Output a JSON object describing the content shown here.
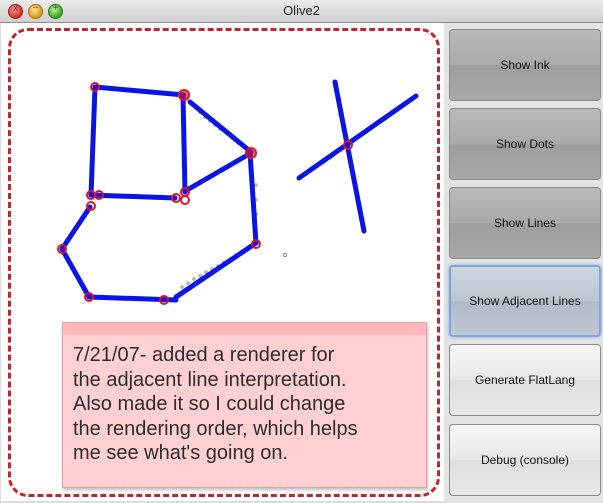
{
  "window": {
    "title": "Olive2"
  },
  "traffic_lights": {
    "close": "x",
    "minimize": "−",
    "maximize": "+"
  },
  "buttons": {
    "show_ink": "Show Ink",
    "show_dots": "Show Dots",
    "show_lines": "Show Lines",
    "show_adjacent_lines": "Show Adjacent Lines",
    "generate_flatlang": "Generate FlatLang",
    "debug_console": "Debug (console)"
  },
  "note": {
    "lines": [
      "7/21/07- added a renderer for",
      "the adjacent line interpretation.",
      "Also made it so I could change",
      "the rendering order, which helps",
      "me see what's going on."
    ]
  },
  "colors": {
    "line": "#0a14e6",
    "endpoint": "#e0141e",
    "dash_border": "#c0242c",
    "note_bg": "#ffd0d2"
  }
}
